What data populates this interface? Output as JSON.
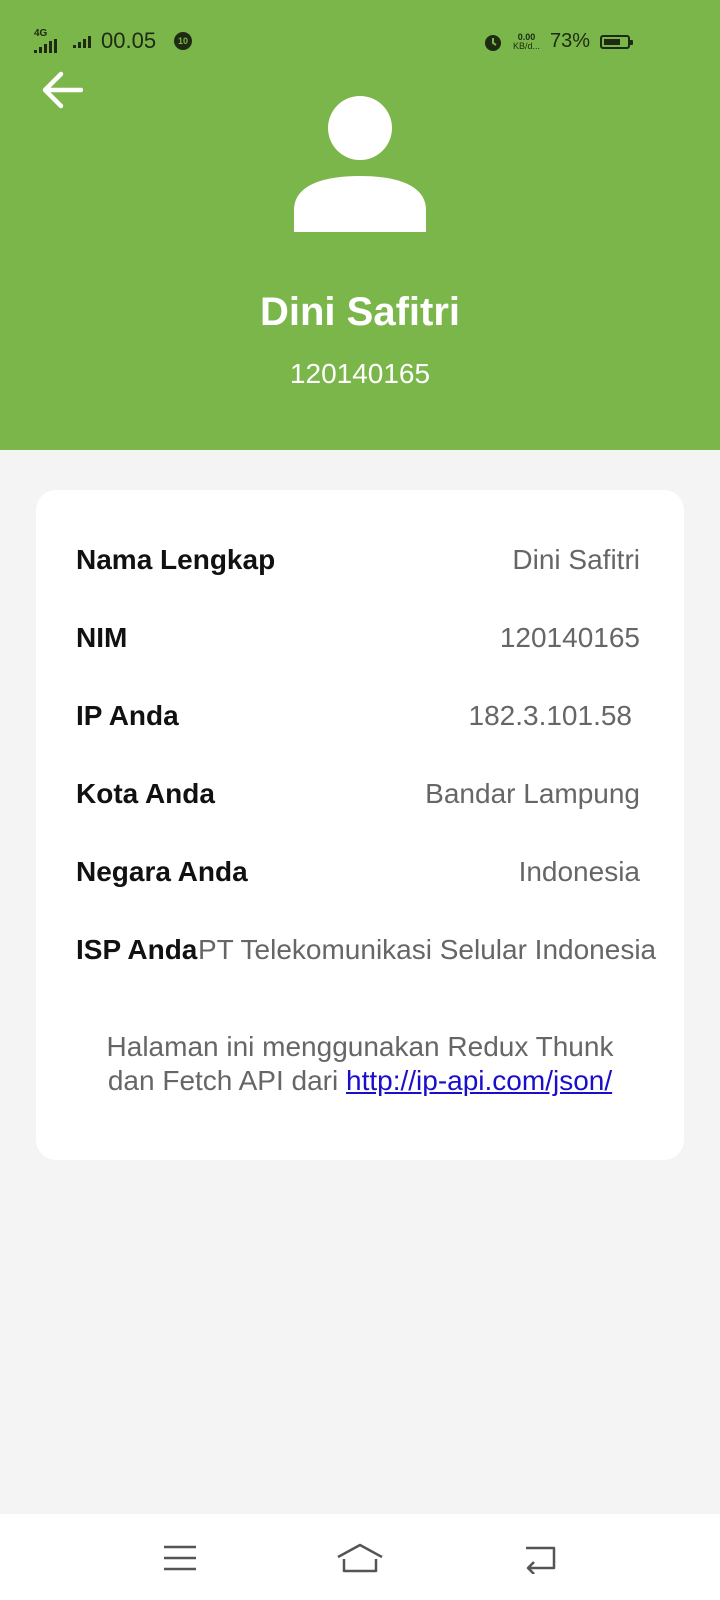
{
  "status_bar": {
    "net_tag": "4G",
    "time": "00.05",
    "notif_badge": "10",
    "speed_value": "0.00",
    "speed_unit": "KB/d...",
    "battery": "73%",
    "battery_level": 0.73
  },
  "header": {
    "back_icon": "arrow-left-icon",
    "avatar_icon": "user-avatar-icon",
    "name": "Dini Safitri",
    "nim": "120140165",
    "color": "#7ab64a"
  },
  "info": {
    "rows": [
      {
        "label": "Nama Lengkap",
        "value": "Dini Safitri"
      },
      {
        "label": "NIM",
        "value": "120140165"
      },
      {
        "label": "IP Anda",
        "value": "182.3.101.58"
      },
      {
        "label": "Kota Anda",
        "value": "Bandar Lampung"
      },
      {
        "label": "Negara Anda",
        "value": "Indonesia"
      },
      {
        "label": "ISP Anda",
        "value": "PT Telekomunikasi Selular Indonesia"
      }
    ],
    "note_line1": "Halaman ini menggunakan Redux Thunk",
    "note_line2_prefix": "dan Fetch API dari ",
    "note_link": "http://ip-api.com/json/"
  },
  "nav_bar": {
    "menu_icon": "menu-icon",
    "home_icon": "home-icon",
    "back_icon": "back-icon"
  }
}
